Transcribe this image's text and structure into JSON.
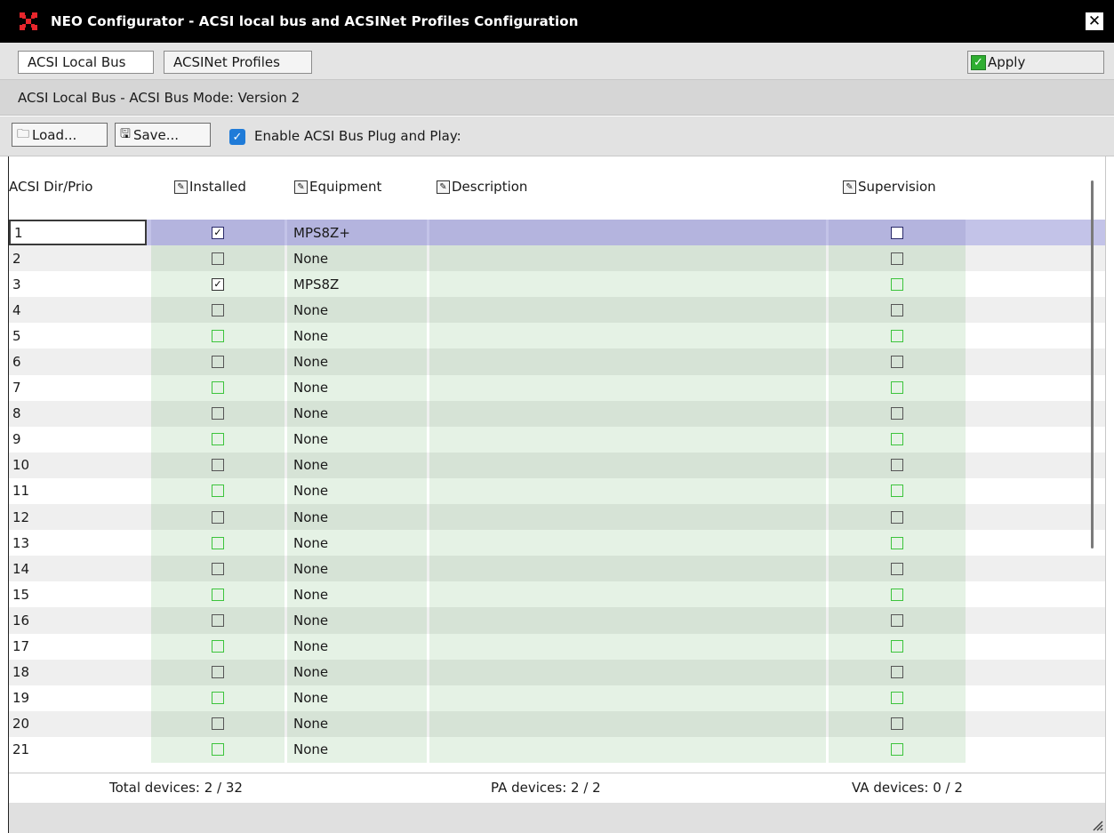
{
  "window": {
    "title": "NEO Configurator - ACSI local bus and ACSINet Profiles Configuration",
    "close_label": "✕"
  },
  "tabs": [
    {
      "label": "ACSI Local Bus",
      "active": true
    },
    {
      "label": "ACSINet Profiles",
      "active": false
    }
  ],
  "apply": {
    "label": "Apply"
  },
  "mode_text": "ACSI Local Bus - ACSI Bus Mode: Version 2",
  "toolbar": {
    "load_label": "Load...",
    "save_label": "Save...",
    "pnp_label": "Enable ACSI Bus Plug and Play:",
    "pnp_checked": true
  },
  "columns": {
    "dir": "ACSI Dir/Prio",
    "installed": "Installed",
    "equipment": "Equipment",
    "description": "Description",
    "supervision": "Supervision"
  },
  "rows": [
    {
      "dir": "1",
      "installed": true,
      "equipment": "MPS8Z+",
      "description": "",
      "supervision": false,
      "selected": true
    },
    {
      "dir": "2",
      "installed": false,
      "equipment": "None",
      "description": "",
      "supervision": false
    },
    {
      "dir": "3",
      "installed": true,
      "equipment": "MPS8Z",
      "description": "",
      "supervision": false
    },
    {
      "dir": "4",
      "installed": false,
      "equipment": "None",
      "description": "",
      "supervision": false
    },
    {
      "dir": "5",
      "installed": false,
      "equipment": "None",
      "description": "",
      "supervision": false
    },
    {
      "dir": "6",
      "installed": false,
      "equipment": "None",
      "description": "",
      "supervision": false
    },
    {
      "dir": "7",
      "installed": false,
      "equipment": "None",
      "description": "",
      "supervision": false
    },
    {
      "dir": "8",
      "installed": false,
      "equipment": "None",
      "description": "",
      "supervision": false
    },
    {
      "dir": "9",
      "installed": false,
      "equipment": "None",
      "description": "",
      "supervision": false
    },
    {
      "dir": "10",
      "installed": false,
      "equipment": "None",
      "description": "",
      "supervision": false
    },
    {
      "dir": "11",
      "installed": false,
      "equipment": "None",
      "description": "",
      "supervision": false
    },
    {
      "dir": "12",
      "installed": false,
      "equipment": "None",
      "description": "",
      "supervision": false
    },
    {
      "dir": "13",
      "installed": false,
      "equipment": "None",
      "description": "",
      "supervision": false
    },
    {
      "dir": "14",
      "installed": false,
      "equipment": "None",
      "description": "",
      "supervision": false
    },
    {
      "dir": "15",
      "installed": false,
      "equipment": "None",
      "description": "",
      "supervision": false
    },
    {
      "dir": "16",
      "installed": false,
      "equipment": "None",
      "description": "",
      "supervision": false
    },
    {
      "dir": "17",
      "installed": false,
      "equipment": "None",
      "description": "",
      "supervision": false
    },
    {
      "dir": "18",
      "installed": false,
      "equipment": "None",
      "description": "",
      "supervision": false
    },
    {
      "dir": "19",
      "installed": false,
      "equipment": "None",
      "description": "",
      "supervision": false
    },
    {
      "dir": "20",
      "installed": false,
      "equipment": "None",
      "description": "",
      "supervision": false
    },
    {
      "dir": "21",
      "installed": false,
      "equipment": "None",
      "description": "",
      "supervision": false
    }
  ],
  "footer": {
    "total": "Total devices: 2 / 32",
    "pa": "PA devices: 2 / 2",
    "va": "VA devices: 0 / 2"
  },
  "colors": {
    "titlebar": "#000000",
    "selected_row": "#c3c3e8",
    "cell_green": "#e5f2e5",
    "checkbox_green": "#3cc43c",
    "pnp_blue": "#1f7bd8",
    "apply_green": "#2fae31"
  }
}
